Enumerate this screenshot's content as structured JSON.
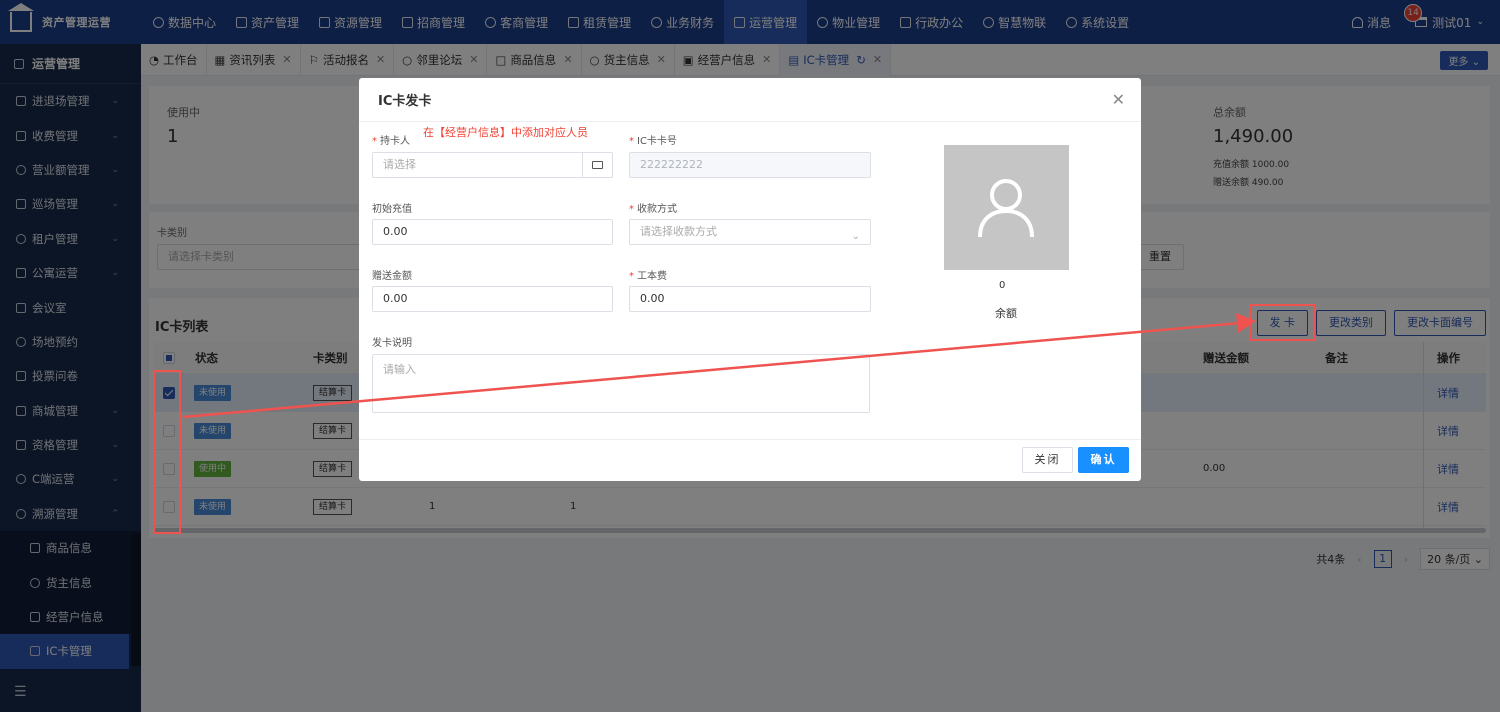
{
  "app": {
    "title": "资产管理运营",
    "messages_label": "消息",
    "messages_count": "14",
    "user": "测试01"
  },
  "nav": [
    "数据中心",
    "资产管理",
    "资源管理",
    "招商管理",
    "客商管理",
    "租赁管理",
    "业务财务",
    "运营管理",
    "物业管理",
    "行政办公",
    "智慧物联",
    "系统设置"
  ],
  "sidebar": {
    "header": "运营管理",
    "items": [
      "进退场管理",
      "收费管理",
      "营业额管理",
      "巡场管理",
      "租户管理",
      "公寓运营",
      "会议室",
      "场地预约",
      "投票问卷",
      "商城管理",
      "资格管理",
      "C端运营",
      "溯源管理"
    ],
    "subitems": [
      "商品信息",
      "货主信息",
      "经营户信息",
      "IC卡管理"
    ]
  },
  "tabs": [
    "工作台",
    "资讯列表",
    "活动报名",
    "邻里论坛",
    "商品信息",
    "货主信息",
    "经营户信息",
    "IC卡管理"
  ],
  "more": "更多",
  "stats": {
    "in_use_label": "使用中",
    "in_use_value": "1",
    "total_label": "总余额",
    "total_value": "1,490.00",
    "recharge": "充值余额 1000.00",
    "gift": "赠送余额 490.00"
  },
  "filter": {
    "label": "卡类别",
    "placeholder": "请选择卡类别",
    "reset": "重置"
  },
  "list": {
    "title": "IC卡列表",
    "buttons": [
      "发 卡",
      "更改类别",
      "更改卡面编号"
    ],
    "headers": {
      "status": "状态",
      "type": "卡类别",
      "gift": "赠送金额",
      "remark": "备注",
      "ops": "操作"
    },
    "rows": [
      {
        "status": "未使用",
        "type": "结算卡",
        "c1": "",
        "c2": "",
        "gift": "",
        "op": "详情"
      },
      {
        "status": "未使用",
        "type": "结算卡",
        "c1": "",
        "c2": "",
        "gift": "",
        "op": "详情"
      },
      {
        "status": "使用中",
        "type": "结算卡",
        "c1": "",
        "c2": "",
        "gift": "0.00",
        "op": "详情"
      },
      {
        "status": "未使用",
        "type": "结算卡",
        "c1": "1",
        "c2": "1",
        "gift": "",
        "op": "详情"
      }
    ]
  },
  "pager": {
    "total": "共4条",
    "page": "1",
    "size": "20 条/页"
  },
  "modal": {
    "title": "IC卡发卡",
    "hint": "在【经营户信息】中添加对应人员",
    "holder_label": "持卡人",
    "holder_ph": "请选择",
    "card_no_label": "IC卡卡号",
    "card_no": "222222222",
    "init_label": "初始充值",
    "init_value": "0.00",
    "pay_label": "收款方式",
    "pay_ph": "请选择收款方式",
    "gift_label": "赠送金额",
    "gift_value": "0.00",
    "fee_label": "工本费",
    "fee_value": "0.00",
    "desc_label": "发卡说明",
    "desc_ph": "请输入",
    "balance": "0",
    "balance_label": "余额",
    "close": "关闭",
    "ok": "确认"
  },
  "colors": {
    "primary": "#2f58b5",
    "topbar": "#1d3f8c",
    "sidebar": "#192a4a",
    "annotation": "#ef5350",
    "ok": "#1890ff"
  }
}
